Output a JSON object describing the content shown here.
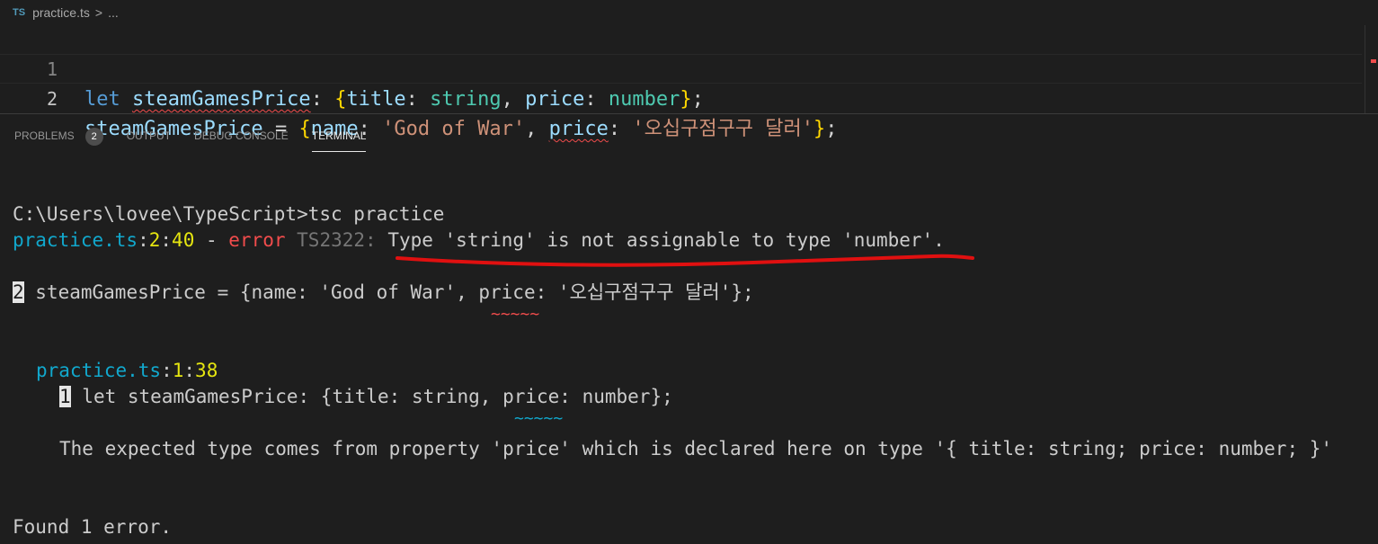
{
  "breadcrumb": {
    "icon": "TS",
    "file": "practice.ts",
    "separator": ">",
    "more": "..."
  },
  "editor": {
    "lines": [
      {
        "number": "1",
        "tokens": [
          "let",
          "steamGamesPrice",
          ":",
          "{",
          "title",
          ":",
          "string",
          ",",
          "price",
          ":",
          "number",
          "}",
          ";"
        ]
      },
      {
        "number": "2",
        "tokens": [
          "steamGamesPrice",
          "=",
          "{",
          "name",
          ":",
          "'God of War'",
          ",",
          "price",
          ":",
          "'오십구점구구 달러'",
          "}",
          ";"
        ]
      }
    ]
  },
  "panel": {
    "tabs": [
      {
        "label": "PROBLEMS",
        "badge": "2"
      },
      {
        "label": "OUTPUT"
      },
      {
        "label": "DEBUG CONSOLE"
      },
      {
        "label": "TERMINAL",
        "active": true
      }
    ]
  },
  "terminal": {
    "prompt": "C:\\Users\\lovee\\TypeScript>tsc practice",
    "error": {
      "file": "practice.ts",
      "line": "2",
      "col": "40",
      "dash": " - ",
      "level": "error",
      "code": "TS2322:",
      "message": "Type 'string' is not assignable to type 'number'."
    },
    "snippet1": {
      "line": "2",
      "code": " steamGamesPrice = {name: 'God of War', price: '오십구점구구 달러'};",
      "tilde": "~~~~~"
    },
    "related": {
      "file": "practice.ts",
      "line": "1",
      "col": "38",
      "snippet_line": "1",
      "snippet_code": " let steamGamesPrice: {title: string, price: number};",
      "tilde": "~~~~~",
      "message": "The expected type comes from property 'price' which is declared here on type '{ title: string; price: number; }'"
    },
    "summary": "Found 1 error."
  },
  "colors": {
    "annotation": "#e01010",
    "background": "#1e1e1e"
  }
}
